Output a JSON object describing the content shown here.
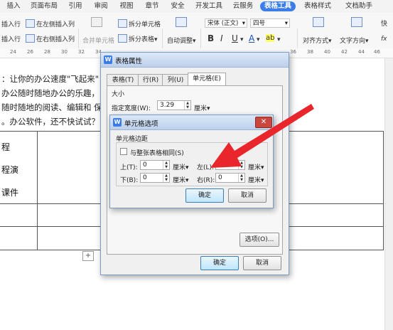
{
  "ribbon_tabs": [
    "插入",
    "页面布局",
    "引用",
    "审阅",
    "视图",
    "章节",
    "安全",
    "开发工具",
    "云服务",
    "表格工具",
    "表格样式",
    "文档助手"
  ],
  "active_tab": "表格工具",
  "ribbon": {
    "insert_row_left": "插入行",
    "insert_col_left": "在左侧插入列",
    "insert_row_right": "插入行",
    "insert_col_right": "在右侧插入列",
    "merge_cells": "合并单元格",
    "split_cells": "拆分单元格",
    "split_table": "拆分表格",
    "auto_adjust": "自动调整",
    "font_name": "宋体 (正文)",
    "font_size": "四号",
    "bold": "B",
    "italic": "I",
    "underline": "U",
    "font_color": "A",
    "highlight": "ab",
    "align": "对齐方式",
    "text_direction": "文字方向",
    "fx": "fx",
    "right_partial": "快"
  },
  "ruler_numbers": [
    "24",
    "26",
    "28",
    "30",
    "32",
    "34",
    "36",
    "38",
    "40",
    "42",
    "44",
    "46"
  ],
  "doc_lines": [
    "：让你的办公速度\"飞起来\"",
    "办公随时随地办公的乐趣，",
    "随时随地的阅读、编辑和 保",
    "。办公软件，还不快试试？"
  ],
  "table_cells": [
    "程",
    "程演",
    "课件"
  ],
  "table_add": "+",
  "dialog_table_props": {
    "title": "表格属性",
    "tabs": [
      "表格(T)",
      "行(R)",
      "列(U)",
      "单元格(E)"
    ],
    "size_label": "大小",
    "width_label": "指定宽度(W):",
    "width_value": "3.29",
    "width_unit": "厘米▾",
    "options_button": "选项(O)...",
    "ok_button": "确定",
    "cancel_button": "取消"
  },
  "dialog_cell_options": {
    "title": "单元格选项",
    "close": "✕",
    "margins_label": "单元格边距",
    "same_as_table": "与整张表格相同(S)",
    "top_label": "上(T):",
    "top_value": "0",
    "left_label": "左(L):",
    "left_value": "0",
    "bottom_label": "下(B):",
    "bottom_value": "0",
    "right_label": "右(R):",
    "right_value": "0",
    "unit": "厘米▾",
    "ok_button": "确定",
    "cancel_button": "取消"
  },
  "colors": {
    "active_tab": "#3d7de8",
    "arrow": "#e8262b",
    "close": "#c9473e"
  }
}
